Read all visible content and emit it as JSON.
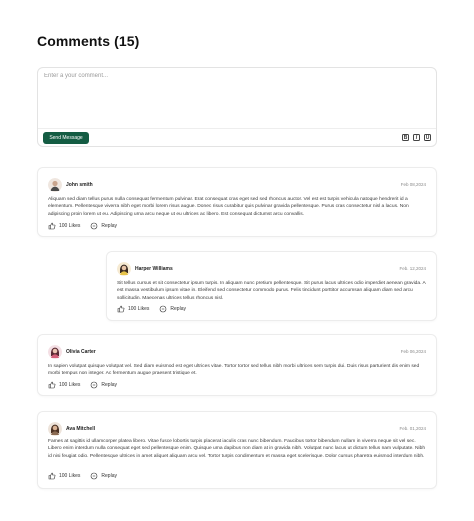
{
  "page": {
    "title": "Comments (15)"
  },
  "composer": {
    "placeholder": "Enter a your comment...",
    "send_label": "Send Message",
    "tools": [
      {
        "icon": "bold-icon",
        "glyph": "B"
      },
      {
        "icon": "italic-icon",
        "glyph": "I"
      },
      {
        "icon": "underline-icon",
        "glyph": "U"
      }
    ]
  },
  "comments": [
    {
      "author": "John smith",
      "date": "Feb 08,2024",
      "text": "Aliquam sed diam tellus purus nulla consequat fermentum pulvinar. Erat consequat cras eget sed sed rhoncus auctor. Vel est est turpis vehicula natoque hendrerit id a elementum. Pellentesque viverra nibh eget morbi lorem risus augue. Donec risus curabitur quis pulvinar gravida pellentesque. Purus cras consectetur nisl a lacus. Non adipiscing proin lorem ut eu. Adipiscing urna arcu neque ut eu ultrices ac libero. Est consequat dictumst arcu convallis.",
      "likes": "100 Likes",
      "reply": "Replay",
      "avatar_color": "#c9a58e"
    },
    {
      "author": "Harper Williams",
      "date": "Feb. 12,2024",
      "text": "Sit tellus cursus et sit consectetur ipsum turpis. In aliquam nunc pretium pellentesque. Sit purus lacus ultrices odio imperdiet aenean gravida. A est massa vestibulum ipsum vitae in. Eleifend sed consectetur commodo purus. Felis tincidunt porttitor accumsan aliquam diam sed arcu sollicitudin. Maecenas ultrices tellus rhoncus nisl.",
      "likes": "100 Likes",
      "reply": "Replay",
      "avatar_color": "#e6c34a"
    },
    {
      "author": "Olivia Carter",
      "date": "Feb 06,2024",
      "text": "In sapien volutpat quisque volutpat vel. Sed diam euismod est eget ultrices vitae. Tortor tortor sed tellus nibh morbi ultrices sem turpis dui. Duis risus parturient dis enim sed morbi tempus non integer. Ac fermentum augue praesent tristique et.",
      "likes": "100 Likes",
      "reply": "Replay",
      "avatar_color": "#d4607a"
    },
    {
      "author": "Ava Mitchell",
      "date": "Feb. 01,2024",
      "text": "Fames at sagittis id ullamcorper platea libero. Vitae fusce lobortis turpis placerat iaculis cras nunc bibendum. Faucibus tortor bibendum nullam in viverra neque sit vel sec. Libero enim interdum nulla consequat eget sed pellentesque enim. Quisque uma dapibus non diam at in gravida nibh. Volutpat nunc lacus ut dictum tellus nam vulputate. Nibh id nisi feugiat odio. Pellentesque ultrices in amet aliquet aliquam arcu vel. Tortor turpis condimentum et massa eget scelerisque. Dolor cursus pharetra euismod interdum nibh.",
      "likes": "100 Likes",
      "reply": "Replay",
      "avatar_color": "#8a6a52"
    }
  ]
}
